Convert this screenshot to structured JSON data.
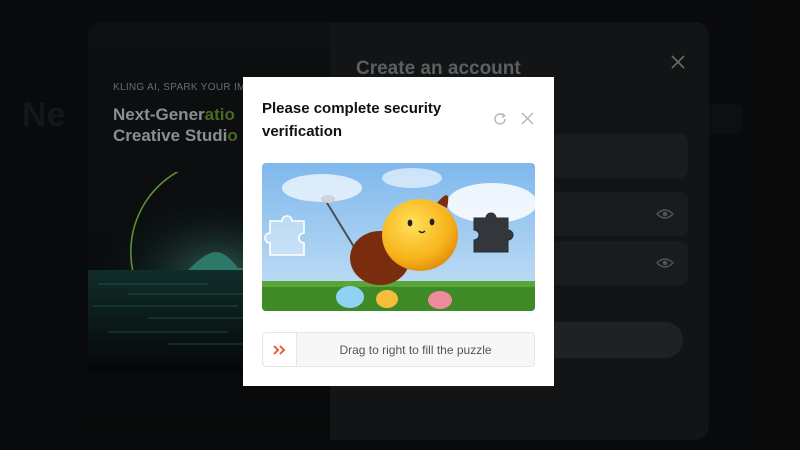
{
  "signup": {
    "tagline": "KLING AI, SPARK YOUR IM",
    "headline_line1_a": "Next-Gener",
    "headline_line1_b": "atio",
    "headline_line2_a": "Creative Studi",
    "headline_line2_b": "o",
    "title": "Create an account"
  },
  "captcha": {
    "title": "Please complete security verification",
    "slider_text": "Drag to right to fill the puzzle"
  },
  "colors": {
    "accent": "#5f8e2a",
    "handle_arrow": "#e8541c"
  },
  "icons": {
    "refresh": "refresh-icon",
    "close": "close-icon",
    "eye": "eye-icon",
    "handle": "double-chevron-right-icon"
  }
}
